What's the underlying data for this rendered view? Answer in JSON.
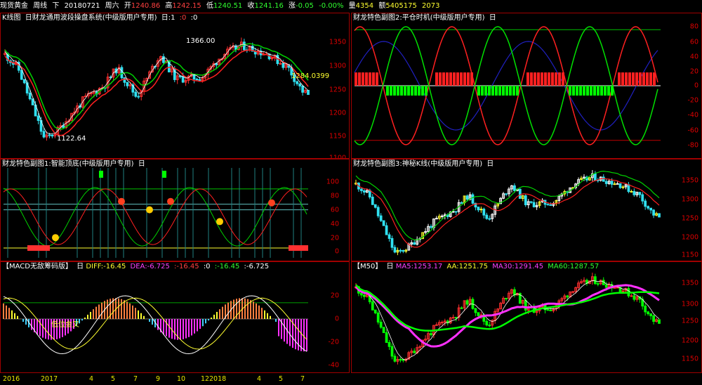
{
  "header": {
    "symbol": "现货黄金",
    "period": "周线",
    "direction_label": "下",
    "date": "20180721",
    "weekday": "周六",
    "open_label": "开",
    "open": "1240.86",
    "high_label": "高",
    "high": "1242.15",
    "low_label": "低",
    "low": "1240.51",
    "close_label": "收",
    "close": "1241.16",
    "change_label": "涨",
    "change": "-0.05",
    "change_pct": "-0.00%",
    "volume_label": "量",
    "volume": "4354",
    "amount_label": "额",
    "amount": "5405175",
    "extra": "2073"
  },
  "main_panel": {
    "title": "K线图",
    "indicator": "日财龙通用波段操盘系统(中级版用户专用)",
    "param1": "日:1",
    "param2": ":0",
    "param3": ":0",
    "high_annotation": "1366.00",
    "low_annotation": "1122.64",
    "price_annotation": "1284.0399",
    "axis": [
      "1350",
      "1300",
      "1250",
      "1200",
      "1150",
      "1100"
    ]
  },
  "sub2_panel": {
    "title": "财龙特色副图2:平仓时机(中级版用户专用)",
    "icon": "日",
    "axis": [
      "80",
      "60",
      "40",
      "20",
      "0",
      "-20",
      "-40",
      "-60",
      "-80"
    ]
  },
  "sub1_panel": {
    "title": "财龙特色副图1:智能顶底(中级版用户专用)",
    "icon": "日",
    "axis": [
      "100",
      "80",
      "60",
      "40",
      "20",
      "0"
    ]
  },
  "sub3_panel": {
    "title": "财龙特色副图3:神秘K线(中级版用户专用)",
    "icon": "日",
    "axis": [
      "1350",
      "1300",
      "1250",
      "1200",
      "1150"
    ]
  },
  "macd_panel": {
    "title": "【MACD无敌筹码版】",
    "icon": "日",
    "diff": "DIFF:-16.45",
    "dea": "DEA:-6.725",
    "v3": ":-16.45",
    "v4": ":0",
    "v5": ":-16.45",
    "v6": ":-6.725",
    "cross_label": "低位金叉",
    "axis": [
      "20",
      "0",
      "-20",
      "-40"
    ]
  },
  "m50_panel": {
    "title": "【M50】",
    "icon": "日",
    "ma5": "MA5:1253.17",
    "aa": "AA:1251.75",
    "ma30": "MA30:1291.45",
    "ma60": "MA60:1287.57",
    "axis": [
      "1350",
      "1300",
      "1250",
      "1200",
      "1150"
    ]
  },
  "time_axis": [
    {
      "label": "2016"
    },
    {
      "label": "2017"
    },
    {
      "label": "4"
    },
    {
      "label": "5"
    },
    {
      "label": "7"
    },
    {
      "label": "9"
    },
    {
      "label": "10"
    },
    {
      "label": "12"
    },
    {
      "label": "2018"
    },
    {
      "label": "4"
    },
    {
      "label": "5"
    },
    {
      "label": "7"
    }
  ],
  "colors": {
    "frame": "#a00000",
    "up": "#ff3030",
    "down": "#30e0f0",
    "yellow": "#ffff30",
    "green": "#00ff00",
    "magenta": "#ff30ff",
    "navy": "#2020c0"
  }
}
